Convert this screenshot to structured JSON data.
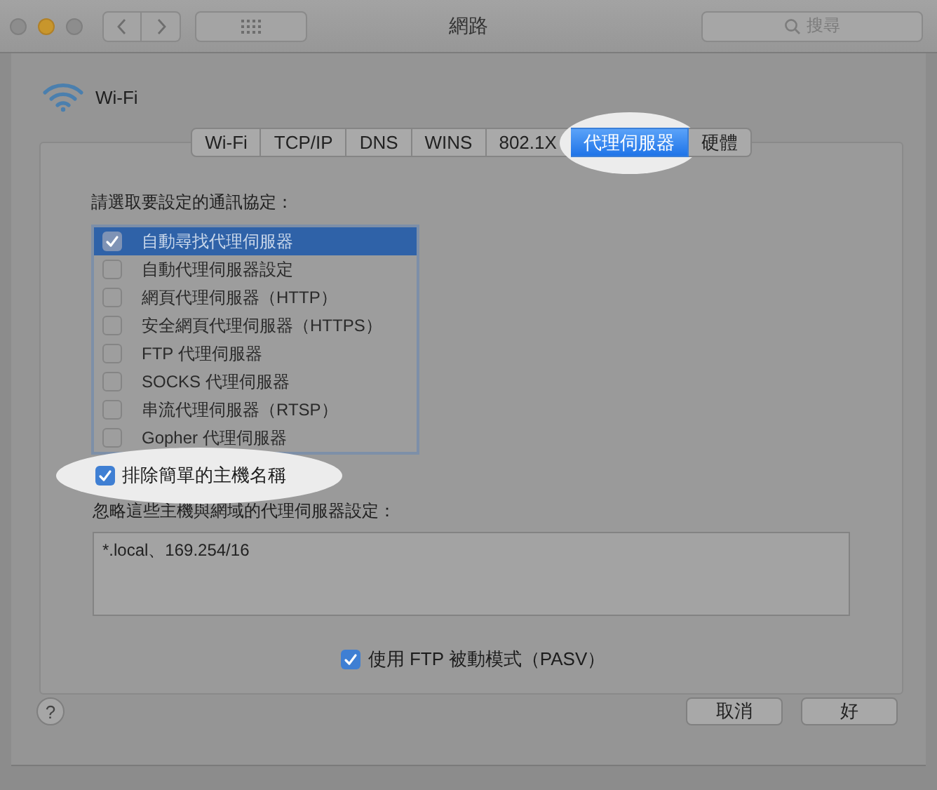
{
  "window": {
    "title": "網路",
    "search": {
      "placeholder": "搜尋"
    }
  },
  "interface": {
    "name": "Wi-Fi"
  },
  "tabs": [
    {
      "label": "Wi-Fi",
      "selected": false,
      "highlighted": false
    },
    {
      "label": "TCP/IP",
      "selected": false,
      "highlighted": false
    },
    {
      "label": "DNS",
      "selected": false,
      "highlighted": false
    },
    {
      "label": "WINS",
      "selected": false,
      "highlighted": false
    },
    {
      "label": "802.1X",
      "selected": false,
      "highlighted": false
    },
    {
      "label": "代理伺服器",
      "selected": true,
      "highlighted": true
    },
    {
      "label": "硬體",
      "selected": false,
      "highlighted": false
    }
  ],
  "protocols": {
    "label": "請選取要設定的通訊協定：",
    "items": [
      {
        "label": "自動尋找代理伺服器",
        "checked": true,
        "selected": true
      },
      {
        "label": "自動代理伺服器設定",
        "checked": false,
        "selected": false
      },
      {
        "label": "網頁代理伺服器（HTTP）",
        "checked": false,
        "selected": false
      },
      {
        "label": "安全網頁代理伺服器（HTTPS）",
        "checked": false,
        "selected": false
      },
      {
        "label": "FTP 代理伺服器",
        "checked": false,
        "selected": false
      },
      {
        "label": "SOCKS 代理伺服器",
        "checked": false,
        "selected": false
      },
      {
        "label": "串流代理伺服器（RTSP）",
        "checked": false,
        "selected": false
      },
      {
        "label": "Gopher 代理伺服器",
        "checked": false,
        "selected": false
      }
    ]
  },
  "exclude_simple_hostnames": {
    "label": "排除簡單的主機名稱",
    "checked": true,
    "highlighted": true
  },
  "bypass": {
    "label": "忽略這些主機與網域的代理伺服器設定：",
    "value": "*.local、169.254/16"
  },
  "pasv": {
    "label": "使用 FTP 被動模式（PASV）",
    "checked": true
  },
  "help": "?",
  "buttons": [
    "取消",
    "好"
  ]
}
